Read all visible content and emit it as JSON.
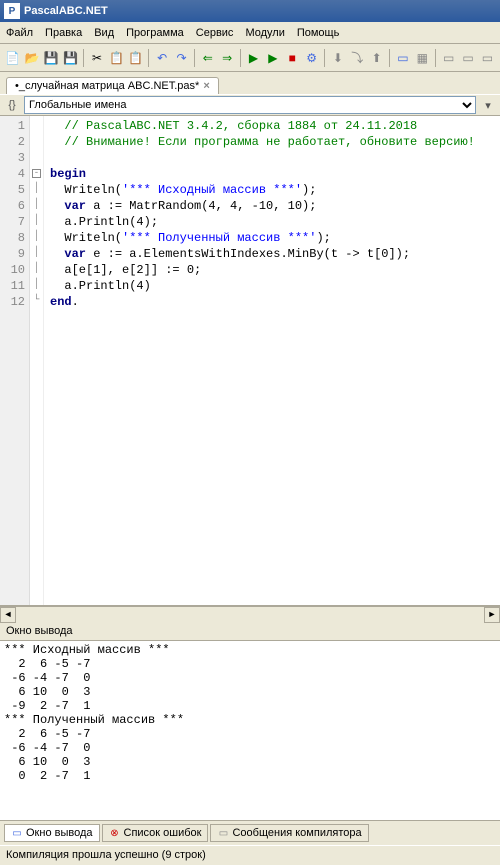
{
  "window": {
    "title": "PascalABC.NET"
  },
  "menu": {
    "file": "Файл",
    "edit": "Правка",
    "view": "Вид",
    "program": "Программа",
    "service": "Сервис",
    "modules": "Модули",
    "help": "Помощь"
  },
  "tab": {
    "label": "•_случайная матрица ABC.NET.pas*",
    "close": "×"
  },
  "scope": {
    "placeholder": "Глобальные имена"
  },
  "code": {
    "lines": [
      "1",
      "2",
      "3",
      "4",
      "5",
      "6",
      "7",
      "8",
      "9",
      "10",
      "11",
      "12"
    ],
    "l1": "  // PascalABC.NET 3.4.2, сборка 1884 от 24.11.2018",
    "l2": "  // Внимание! Если программа не работает, обновите версию!",
    "l3": "",
    "l4_kw": "begin",
    "l5a": "  Writeln(",
    "l5s": "'*** Исходный массив ***'",
    "l5b": ");",
    "l6a": "  ",
    "l6kw": "var",
    "l6b": " a := MatrRandom(4, 4, -10, 10);",
    "l7": "  a.Println(4);",
    "l8a": "  Writeln(",
    "l8s": "'*** Полученный массив ***'",
    "l8b": ");",
    "l9a": "  ",
    "l9kw": "var",
    "l9b": " e := a.ElementsWithIndexes.MinBy(t -> t[0]);",
    "l10": "  a[e[1], e[2]] := 0;",
    "l11": "  a.Println(4)",
    "l12_kw": "end",
    "l12_dot": "."
  },
  "output": {
    "title": "Окно вывода",
    "text": "*** Исходный массив ***\n  2  6 -5 -7\n -6 -4 -7  0\n  6 10  0  3\n -9  2 -7  1\n*** Полученный массив ***\n  2  6 -5 -7\n -6 -4 -7  0\n  6 10  0  3\n  0  2 -7  1"
  },
  "bottom_tabs": {
    "output": "Окно вывода",
    "errors": "Список ошибок",
    "compiler": "Сообщения компилятора"
  },
  "status": {
    "text": "Компиляция прошла успешно (9 строк)"
  }
}
